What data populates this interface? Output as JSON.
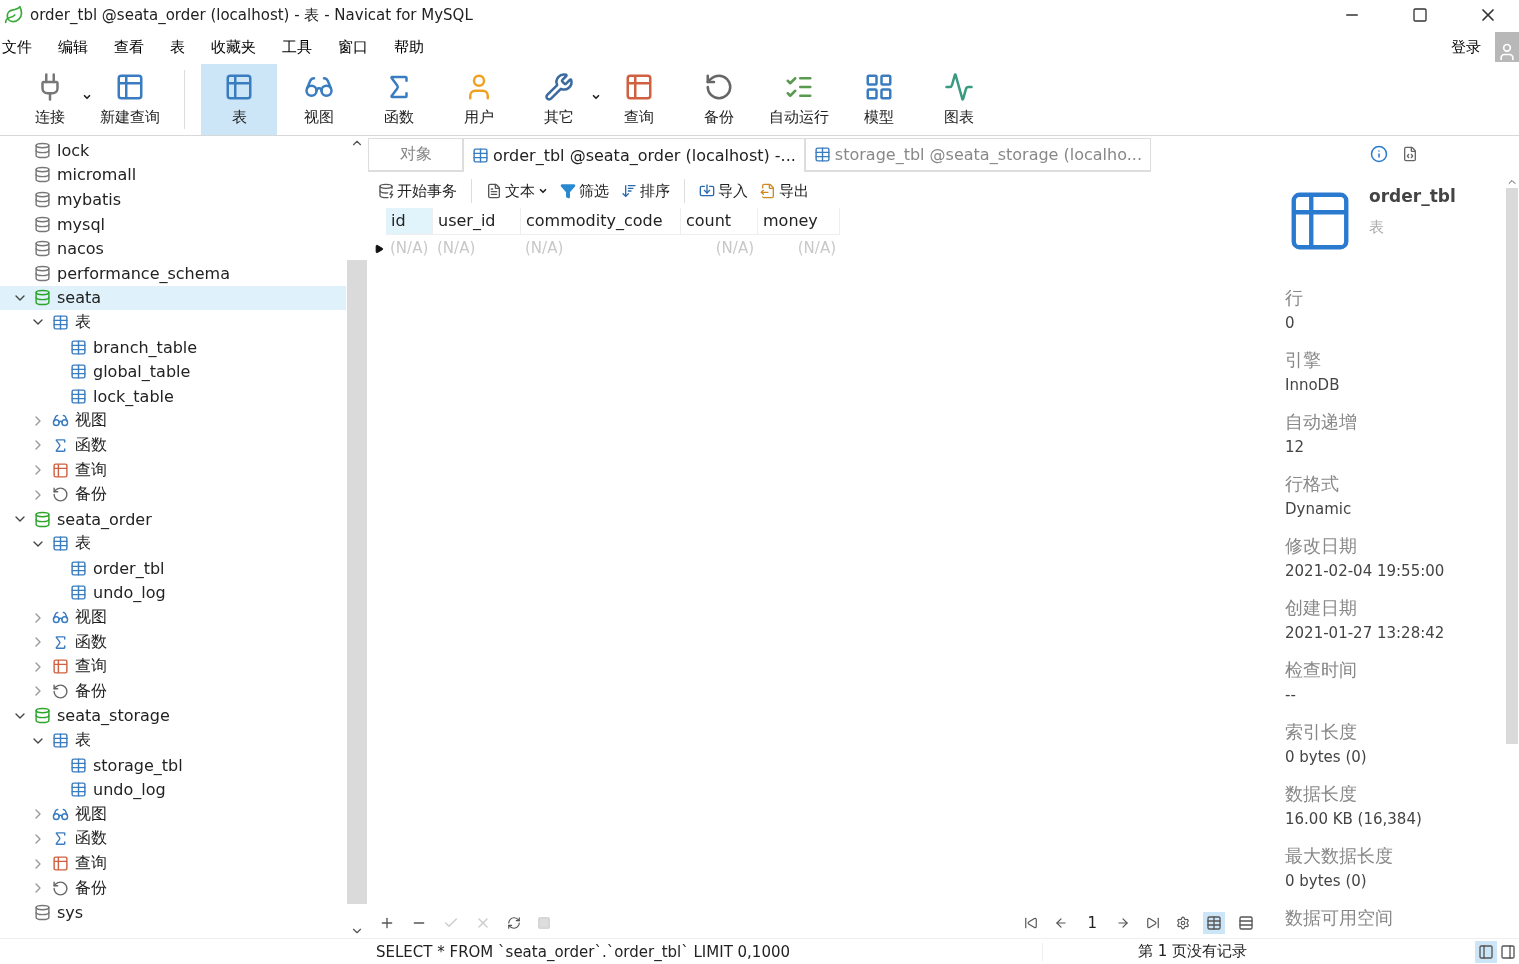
{
  "window": {
    "title": "order_tbl @seata_order (localhost) - 表 - Navicat for MySQL"
  },
  "menu": [
    "文件",
    "编辑",
    "查看",
    "表",
    "收藏夹",
    "工具",
    "窗口",
    "帮助"
  ],
  "login": "登录",
  "toolbar": [
    {
      "kind": "connect",
      "label": "连接",
      "dropdown": true,
      "selected": false
    },
    {
      "kind": "new-query",
      "label": "新建查询",
      "dropdown": false,
      "selected": false
    },
    {
      "kind": "table",
      "label": "表",
      "dropdown": false,
      "selected": true
    },
    {
      "kind": "view",
      "label": "视图",
      "dropdown": false,
      "selected": false
    },
    {
      "kind": "function",
      "label": "函数",
      "dropdown": false,
      "selected": false
    },
    {
      "kind": "user",
      "label": "用户",
      "dropdown": false,
      "selected": false
    },
    {
      "kind": "other",
      "label": "其它",
      "dropdown": true,
      "selected": false
    },
    {
      "kind": "query",
      "label": "查询",
      "dropdown": false,
      "selected": false
    },
    {
      "kind": "backup",
      "label": "备份",
      "dropdown": false,
      "selected": false
    },
    {
      "kind": "automation",
      "label": "自动运行",
      "dropdown": false,
      "selected": false
    },
    {
      "kind": "model",
      "label": "模型",
      "dropdown": false,
      "selected": false
    },
    {
      "kind": "chart",
      "label": "图表",
      "dropdown": false,
      "selected": false
    }
  ],
  "tree": [
    {
      "kind": "database",
      "label": "lock",
      "selected": false
    },
    {
      "kind": "database",
      "label": "micromall",
      "selected": false
    },
    {
      "kind": "database",
      "label": "mybatis",
      "selected": false
    },
    {
      "kind": "database",
      "label": "mysql",
      "selected": false
    },
    {
      "kind": "database",
      "label": "nacos",
      "selected": false
    },
    {
      "kind": "database",
      "label": "performance_schema",
      "selected": false
    },
    {
      "kind": "database",
      "label": "seata",
      "selected": true,
      "expanded": true,
      "children": [
        {
          "kind": "tables",
          "label": "表",
          "selected": false,
          "expanded": true,
          "children": [
            {
              "kind": "table",
              "label": "branch_table",
              "selected": false
            },
            {
              "kind": "table",
              "label": "global_table",
              "selected": false
            },
            {
              "kind": "table",
              "label": "lock_table",
              "selected": false
            }
          ]
        },
        {
          "kind": "view",
          "label": "视图",
          "selected": false,
          "expanded": false
        },
        {
          "kind": "function",
          "label": "函数",
          "selected": false,
          "expanded": false
        },
        {
          "kind": "query",
          "label": "查询",
          "selected": false,
          "expanded": false
        },
        {
          "kind": "backup",
          "label": "备份",
          "selected": false,
          "expanded": false
        }
      ]
    },
    {
      "kind": "database",
      "label": "seata_order",
      "selected": false,
      "expanded": true,
      "children": [
        {
          "kind": "tables",
          "label": "表",
          "selected": false,
          "expanded": true,
          "children": [
            {
              "kind": "table",
              "label": "order_tbl",
              "selected": false
            },
            {
              "kind": "table",
              "label": "undo_log",
              "selected": false
            }
          ]
        },
        {
          "kind": "view",
          "label": "视图",
          "selected": false,
          "expanded": false
        },
        {
          "kind": "function",
          "label": "函数",
          "selected": false,
          "expanded": false
        },
        {
          "kind": "query",
          "label": "查询",
          "selected": false,
          "expanded": false
        },
        {
          "kind": "backup",
          "label": "备份",
          "selected": false,
          "expanded": false
        }
      ]
    },
    {
      "kind": "database",
      "label": "seata_storage",
      "selected": false,
      "expanded": true,
      "children": [
        {
          "kind": "tables",
          "label": "表",
          "selected": false,
          "expanded": true,
          "children": [
            {
              "kind": "table",
              "label": "storage_tbl",
              "selected": false
            },
            {
              "kind": "table",
              "label": "undo_log",
              "selected": false
            }
          ]
        },
        {
          "kind": "view",
          "label": "视图",
          "selected": false,
          "expanded": false
        },
        {
          "kind": "function",
          "label": "函数",
          "selected": false,
          "expanded": false
        },
        {
          "kind": "query",
          "label": "查询",
          "selected": false,
          "expanded": false
        },
        {
          "kind": "backup",
          "label": "备份",
          "selected": false,
          "expanded": false
        }
      ]
    },
    {
      "kind": "database",
      "label": "sys",
      "selected": false
    }
  ],
  "tabs": [
    {
      "kind": "objects",
      "label": "对象",
      "selected": false
    },
    {
      "kind": "table",
      "label": "order_tbl @seata_order (localhost) -...",
      "selected": true
    },
    {
      "kind": "table",
      "label": "storage_tbl @seata_storage (localho...",
      "selected": false
    }
  ],
  "grid_toolbar": [
    {
      "kind": "transaction",
      "label": "开始事务",
      "dropdown": false
    },
    {
      "kind": "text",
      "label": "文本",
      "dropdown": true
    },
    {
      "kind": "filter",
      "label": "筛选",
      "dropdown": false
    },
    {
      "kind": "sort",
      "label": "排序",
      "dropdown": false
    },
    {
      "kind": "import",
      "label": "导入",
      "dropdown": false
    },
    {
      "kind": "export",
      "label": "导出",
      "dropdown": false
    }
  ],
  "table": {
    "columns": [
      {
        "label": "id",
        "kind": "text",
        "selected": true
      },
      {
        "label": "user_id",
        "kind": "text",
        "selected": false
      },
      {
        "label": "commodity_code",
        "kind": "text",
        "selected": false
      },
      {
        "label": "count",
        "kind": "number",
        "selected": false
      },
      {
        "label": "money",
        "kind": "number",
        "selected": false
      }
    ],
    "rows": [
      [
        "(N/A)",
        "(N/A)",
        "(N/A)",
        "(N/A)",
        "(N/A)"
      ]
    ]
  },
  "pager": {
    "page": "1"
  },
  "views": [
    {
      "kind": "grid",
      "selected": true
    },
    {
      "kind": "form",
      "selected": false
    }
  ],
  "info": {
    "name": "order_tbl",
    "type": "表",
    "properties": [
      {
        "label": "行",
        "value": "0"
      },
      {
        "label": "引擎",
        "value": "InnoDB"
      },
      {
        "label": "自动递增",
        "value": "12"
      },
      {
        "label": "行格式",
        "value": "Dynamic"
      },
      {
        "label": "修改日期",
        "value": "2021-02-04 19:55:00"
      },
      {
        "label": "创建日期",
        "value": "2021-01-27 13:28:42"
      },
      {
        "label": "检查时间",
        "value": "--"
      },
      {
        "label": "索引长度",
        "value": "0 bytes (0)"
      },
      {
        "label": "数据长度",
        "value": "16.00 KB (16,384)"
      },
      {
        "label": "最大数据长度",
        "value": "0 bytes (0)"
      },
      {
        "label": "数据可用空间"
      }
    ]
  },
  "status_bar": {
    "sql": "SELECT * FROM `seata_order`.`order_tbl` LIMIT 0,1000",
    "page_info": "第 1 页没有记录",
    "layouts": [
      {
        "selected": true
      },
      {
        "selected": false
      }
    ]
  }
}
